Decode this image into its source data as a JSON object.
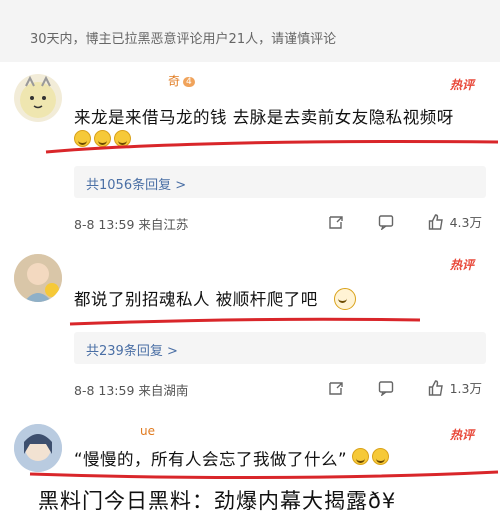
{
  "notice": "30天内，博主已拉黑恶意评论用户21人，请谨慎评论",
  "comments": [
    {
      "username": "奇",
      "badge": "4",
      "hot": "热评",
      "text": "来龙是来借马龙的钱 去脉是去卖前女友隐私视频呀",
      "replies": "共1056条回复 >",
      "meta": "8-8 13:59  来自江苏",
      "likes": "4.3万"
    },
    {
      "username": "",
      "hot": "热评",
      "text": "都说了别招魂私人 被顺杆爬了吧",
      "replies": "共239条回复 >",
      "meta": "8-8 13:59  来自湖南",
      "likes": "1.3万"
    },
    {
      "username": "ue",
      "hot": "热评",
      "text": "“慢慢的，所有人会忘了我做了什么”"
    }
  ],
  "caption": "黑料门今日黑料：劲爆内幕大揭露ð¥",
  "colors": {
    "hot": "#e8483a",
    "link": "#4a6fa5",
    "underline": "#d9262a"
  },
  "icons": [
    "share-icon",
    "comment-icon",
    "like-icon"
  ]
}
